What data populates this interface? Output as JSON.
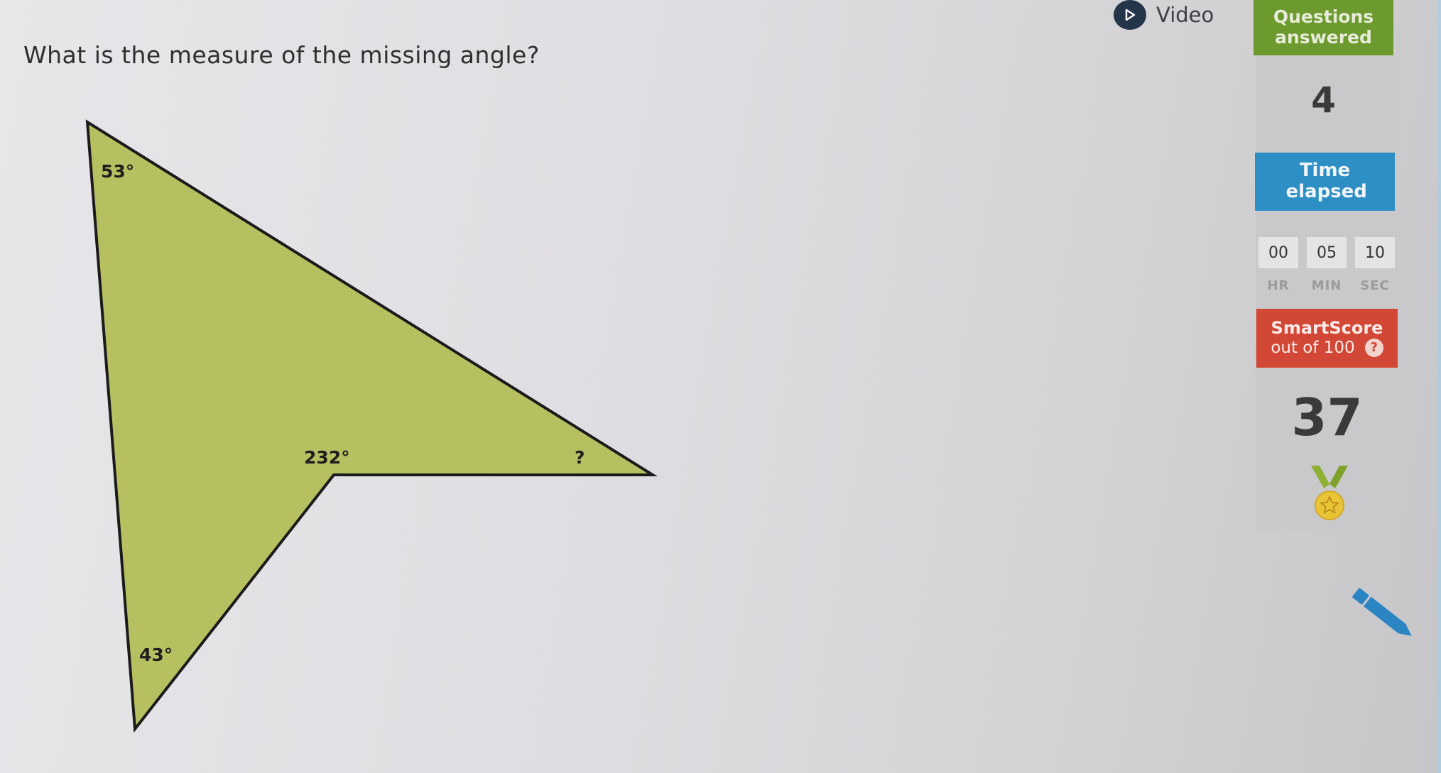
{
  "question": {
    "text": "What is the measure of the missing angle?"
  },
  "figure": {
    "fill_color": "#b7c060",
    "stroke_color": "#1b1b1b",
    "angles": {
      "top": "53°",
      "bottom": "43°",
      "reflex": "232°",
      "missing": "?"
    }
  },
  "video": {
    "label": "Video",
    "icon": "play-circle-icon"
  },
  "questions_answered": {
    "label": "Questions answered",
    "value": "4",
    "color": "#6d9a2e"
  },
  "time_elapsed": {
    "label": "Time elapsed",
    "color": "#2d8fc4",
    "hours": "00",
    "minutes": "05",
    "seconds": "10",
    "hours_unit": "HR",
    "minutes_unit": "MIN",
    "seconds_unit": "SEC"
  },
  "smartscore": {
    "label": "SmartScore",
    "sublabel": "out of 100",
    "help": "?",
    "value": "37",
    "color": "#d24735",
    "medal_icon": "medal-icon"
  },
  "tools": {
    "pencil_icon": "pencil-icon"
  }
}
